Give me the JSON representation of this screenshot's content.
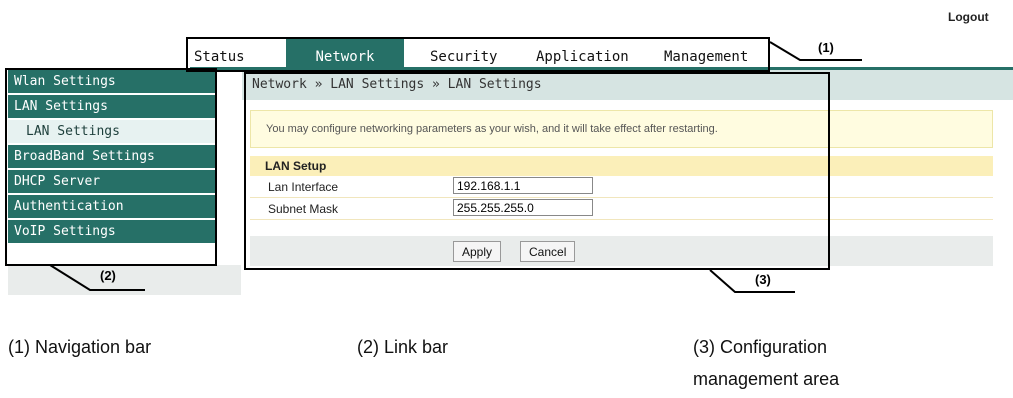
{
  "header": {
    "logout_label": "Logout"
  },
  "top_nav": {
    "tabs": [
      {
        "label": "Status"
      },
      {
        "label": "Network",
        "active": true
      },
      {
        "label": "Security"
      },
      {
        "label": "Application"
      },
      {
        "label": "Management"
      }
    ]
  },
  "sidebar": {
    "items": [
      {
        "label": "Wlan Settings"
      },
      {
        "label": "LAN Settings"
      },
      {
        "label": "LAN Settings",
        "sub": true,
        "selected": true
      },
      {
        "label": "BroadBand Settings"
      },
      {
        "label": "DHCP Server"
      },
      {
        "label": "Authentication"
      },
      {
        "label": "VoIP Settings"
      }
    ]
  },
  "content": {
    "breadcrumb": "Network » LAN Settings » LAN Settings",
    "notice": "You may configure networking parameters as your wish, and it will take effect after restarting.",
    "section_title": "LAN Setup",
    "fields": [
      {
        "label": "Lan Interface",
        "value": "192.168.1.1"
      },
      {
        "label": "Subnet Mask",
        "value": "255.255.255.0"
      }
    ],
    "apply_label": "Apply",
    "cancel_label": "Cancel"
  },
  "callouts": {
    "nav": "(1)",
    "link": "(2)",
    "config": "(3)"
  },
  "captions": {
    "nav": "(1) Navigation bar",
    "link": "(2) Link bar",
    "config_line1": "(3) Configuration",
    "config_line2": "management area"
  },
  "colors": {
    "theme_green": "#267067",
    "breadcrumb_bg": "#d6e4e2",
    "notice_bg": "#fffce0",
    "section_bg": "#fbefb9"
  }
}
